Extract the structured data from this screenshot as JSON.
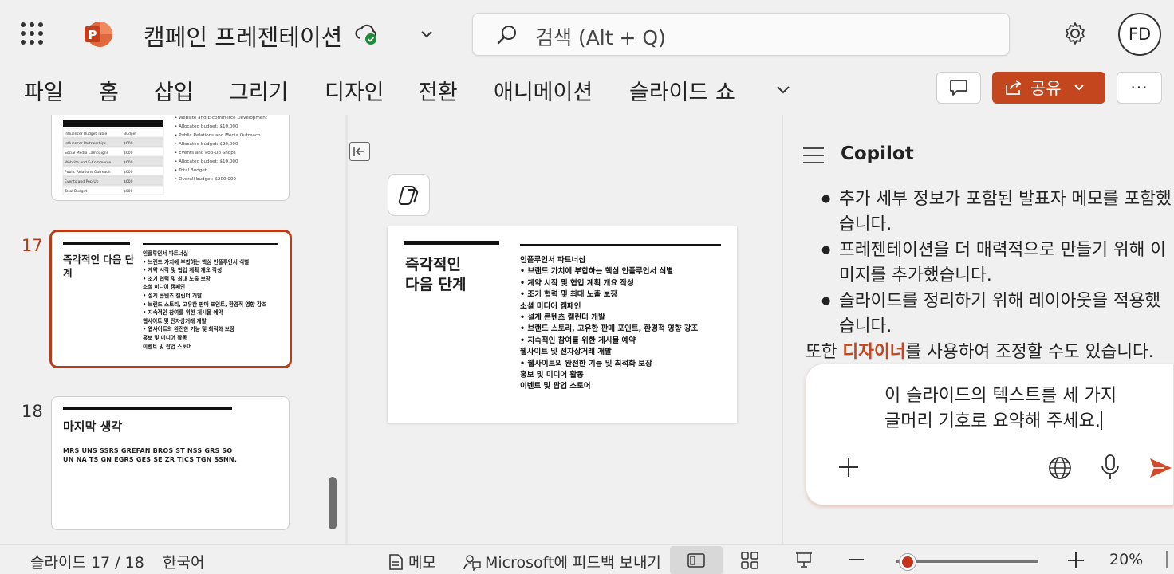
{
  "app": {
    "doc_title": "캠페인 프레젠테이션",
    "search_placeholder": "검색 (Alt + Q)",
    "avatar_initials": "FD",
    "brand_color": "#c4461f",
    "icons": [
      "app-launcher-icon",
      "powerpoint-logo-icon",
      "cloud-saved-icon",
      "chevron-down-icon",
      "search-icon",
      "gear-icon"
    ]
  },
  "ribbon": {
    "tabs": [
      "파일",
      "홈",
      "삽입",
      "그리기",
      "디자인",
      "전환",
      "애니메이션",
      "슬라이드 쇼"
    ],
    "share_label": "공유",
    "more_label": "···"
  },
  "thumbnails": {
    "prev": {
      "rows": [
        [
          "Influencer Budget Table",
          "Budget"
        ],
        [
          "Influencer Partnerships",
          "$000"
        ],
        [
          "Social Media Campaigns",
          "$000"
        ],
        [
          "Website and E-Commerce",
          "$000"
        ],
        [
          "Public Relations Outreach",
          "$000"
        ],
        [
          "Events and Pop-Up",
          "$000"
        ],
        [
          "Total Budget",
          "$000"
        ]
      ],
      "bullets": [
        "Website and E-commerce Development",
        "Allocated budget: $10,000",
        "Public Relations and Media Outreach",
        "Allocated budget: $20,000",
        "Events and Pop-Up Shops",
        "Allocated budget: $10,000",
        "Total Budget",
        "Overall budget: $200,000"
      ]
    },
    "slide17": {
      "number": "17",
      "title": "즉각적인 다음 단계",
      "lines": [
        "인플루언서 파트너십",
        "• 브랜드 가치에 부합하는 핵심 인플루언서 식별",
        "• 계약 시작 및 협업 계획 개요 작성",
        "• 조기 협력 및 최대 노출 보장",
        "소셜 미디어 캠페인",
        "• 설계 콘텐츠 캘린더 개발",
        "• 브랜드 스토리, 고유한 판매 포인트, 환경적 영향 강조",
        "• 지속적인 참여를 위한 게시물 예약",
        "웹사이트 및 전자상거래 개발",
        "• 웹사이트의 완전한 기능 및 최적화 보장",
        "홍보 및 미디어 활동",
        "이벤트 및 팝업 스토어"
      ]
    },
    "slide18": {
      "number": "18",
      "title": "마지막 생각",
      "body": "MRS UNS SSRS GREFAN BROS ST NSS GRS SO UN NA TS GN EGRS GES SE ZR TICS TGN SSNN."
    }
  },
  "slide": {
    "title_line1": "즉각적인",
    "title_line2": "다음 단계",
    "lines": [
      {
        "text": "인플루언서 파트너십",
        "heading": true
      },
      {
        "text": "• 브랜드 가치에 부합하는 핵심 인플루언서 식별",
        "heading": false
      },
      {
        "text": "• 계약 시작 및 협업 계획 개요 작성",
        "heading": false
      },
      {
        "text": "• 조기 협력 및 최대 노출 보장",
        "heading": false
      },
      {
        "text": "소셜 미디어 캠페인",
        "heading": true
      },
      {
        "text": "• 설계 콘텐츠 캘린더 개발",
        "heading": false
      },
      {
        "text": "• 브랜드 스토리, 고유한 판매 포인트, 환경적 영향 강조",
        "heading": false
      },
      {
        "text": "• 지속적인 참여를 위한 게시물 예약",
        "heading": false
      },
      {
        "text": "웹사이트 및 전자상거래 개발",
        "heading": true
      },
      {
        "text": "• 웹사이트의 완전한 기능 및 최적화 보장",
        "heading": false
      },
      {
        "text": "홍보 및 미디어 활동",
        "heading": true
      },
      {
        "text": "이벤트 및 팝업 스토어",
        "heading": true
      }
    ]
  },
  "copilot": {
    "title": "Copilot",
    "bullets": [
      "추가 세부 정보가 포함된 발표자 메모를 포함했습니다.",
      "프레젠테이션을 더 매력적으로 만들기 위해 이미지를 추가했습니다.",
      "슬라이드를 정리하기 위해 레이아웃을 적용했습니다."
    ],
    "also_prefix": "또한 ",
    "also_link": "디자이너",
    "also_suffix": "를 사용하여 조정할 수도 있습니다.",
    "compose_line1": "이 슬라이드의 텍스트를 세 가지",
    "compose_line2": "글머리 기호로 요약해 주세요."
  },
  "status": {
    "slide_counter": "슬라이드 17 / 18",
    "language": "한국어",
    "notes_label": "메모",
    "feedback_label": "Microsoft에 피드백 보내기",
    "zoom_percent": "20%",
    "zoom_level": 0.2
  }
}
